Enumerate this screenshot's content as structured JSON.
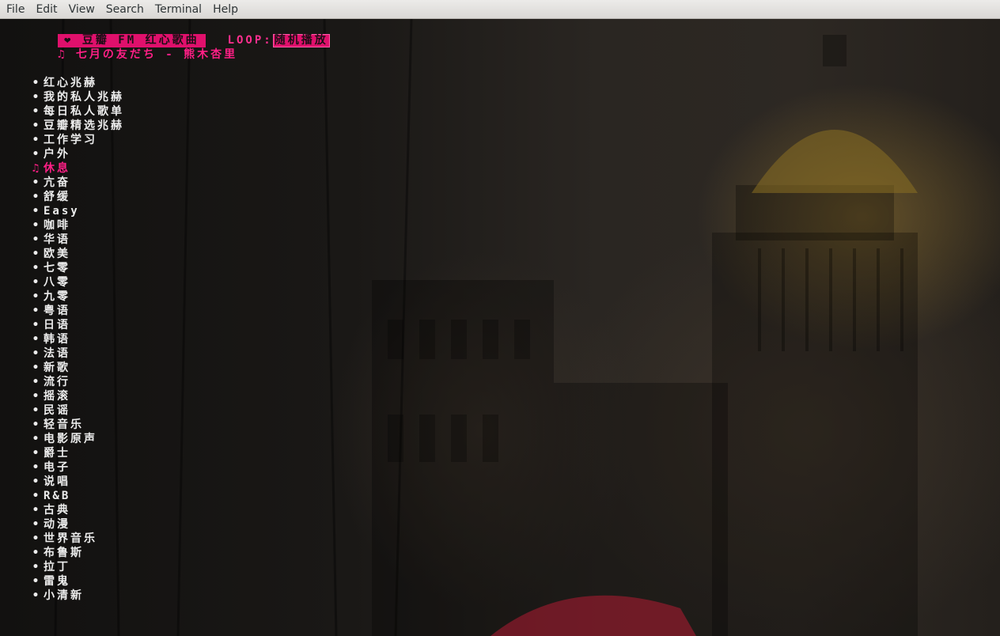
{
  "menubar": {
    "items": [
      "File",
      "Edit",
      "View",
      "Search",
      "Terminal",
      "Help"
    ]
  },
  "header": {
    "station": "❤ 豆瓣 FM 红心歌曲",
    "loop_label": "LOOP:",
    "loop_value": "随机播放",
    "now_playing": "♫ 七月の友だち - 熊木杏里"
  },
  "channels": {
    "bullet": "•",
    "active_marker": "♫",
    "active_index": 6,
    "items": [
      "红心兆赫",
      "我的私人兆赫",
      "每日私人歌单",
      "豆瓣精选兆赫",
      "工作学习",
      "户外",
      "休息",
      "亢奋",
      "舒缓",
      "Easy",
      "咖啡",
      "华语",
      "欧美",
      "七零",
      "八零",
      "九零",
      "粤语",
      "日语",
      "韩语",
      "法语",
      "新歌",
      "流行",
      "摇滚",
      "民谣",
      "轻音乐",
      "电影原声",
      "爵士",
      "电子",
      "说唱",
      "R&B",
      "古典",
      "动漫",
      "世界音乐",
      "布鲁斯",
      "拉丁",
      "雷鬼",
      "小清新"
    ]
  },
  "colors": {
    "accent": "#e0106c",
    "accent_text": "#ff1f86",
    "text": "#ececec",
    "menubar_bg": "#e6e5e3"
  }
}
